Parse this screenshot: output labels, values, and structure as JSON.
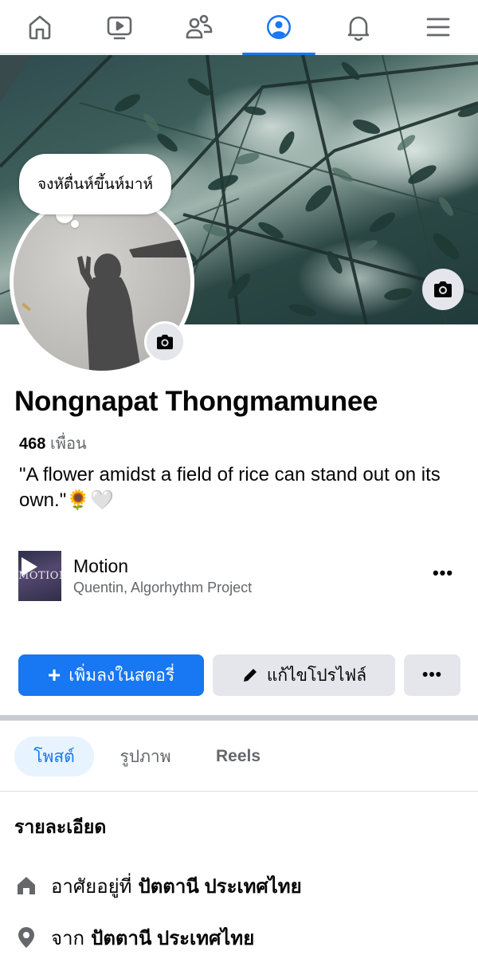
{
  "nav": {
    "items": [
      {
        "name": "home",
        "icon": "home-icon"
      },
      {
        "name": "watch",
        "icon": "video-icon"
      },
      {
        "name": "friends",
        "icon": "friends-icon"
      },
      {
        "name": "profile",
        "icon": "profile-icon",
        "active": true
      },
      {
        "name": "notifications",
        "icon": "bell-icon"
      },
      {
        "name": "menu",
        "icon": "hamburger-icon"
      }
    ],
    "accent_color": "#1877f2"
  },
  "profile": {
    "note": "จงหัตื่นห์ขึ้นห์มาห์",
    "name": "Nongnapat Thongmamunee",
    "friends_count": "468",
    "friends_label": "เพื่อน",
    "bio": "\"A flower amidst a field of rice can stand out on its own.\"🌻🤍"
  },
  "music": {
    "art_text": "MOTION",
    "title": "Motion",
    "artist": "Quentin, Algorhythm Project",
    "more_label": "•••"
  },
  "actions": {
    "add_story_label": "เพิ่มลงในสตอรี่",
    "edit_profile_label": "แก้ไขโปรไฟล์",
    "more_label": "•••"
  },
  "tabs": [
    {
      "label": "โพสต์",
      "active": true
    },
    {
      "label": "รูปภาพ"
    },
    {
      "label": "Reels"
    }
  ],
  "details": {
    "title": "รายละเอียด",
    "lives_prefix": "อาศัยอยู่ที่",
    "lives_value": "ปัตตานี ประเทศไทย",
    "from_prefix": "จาก",
    "from_value": "ปัตตานี ประเทศไทย"
  }
}
